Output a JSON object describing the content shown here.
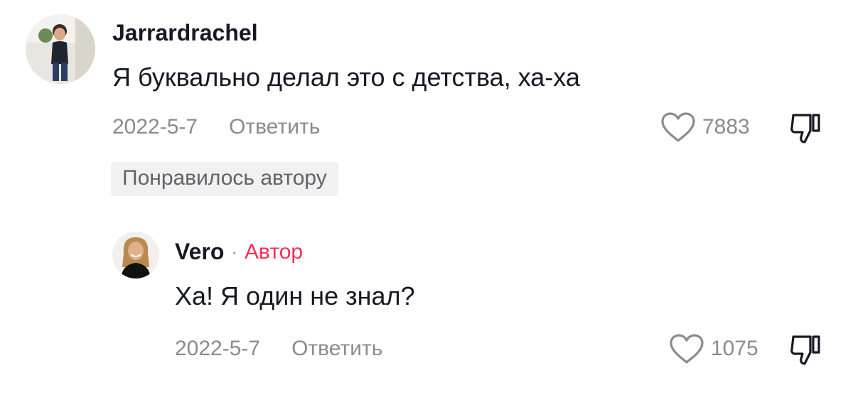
{
  "comments": [
    {
      "username": "Jarrardrachel",
      "text": "Я буквально делал это с детства, ха-ха",
      "date": "2022-5-7",
      "reply_label": "Ответить",
      "likes": "7883",
      "liked_by_author_label": "Понравилось автору",
      "avatar_icon": "user-avatar-photo"
    },
    {
      "username": "Vero",
      "separator": "·",
      "author_badge": "Автор",
      "text": "Ха! Я один не знал?",
      "date": "2022-5-7",
      "reply_label": "Ответить",
      "likes": "1075",
      "avatar_icon": "user-avatar-photo"
    }
  ],
  "icons": {
    "like": "heart-outline-icon",
    "dislike": "thumbs-down-icon"
  },
  "colors": {
    "author_badge": "#fe2c55",
    "secondary_text": "#8a8b91",
    "tag_bg": "#f1f1f2"
  }
}
